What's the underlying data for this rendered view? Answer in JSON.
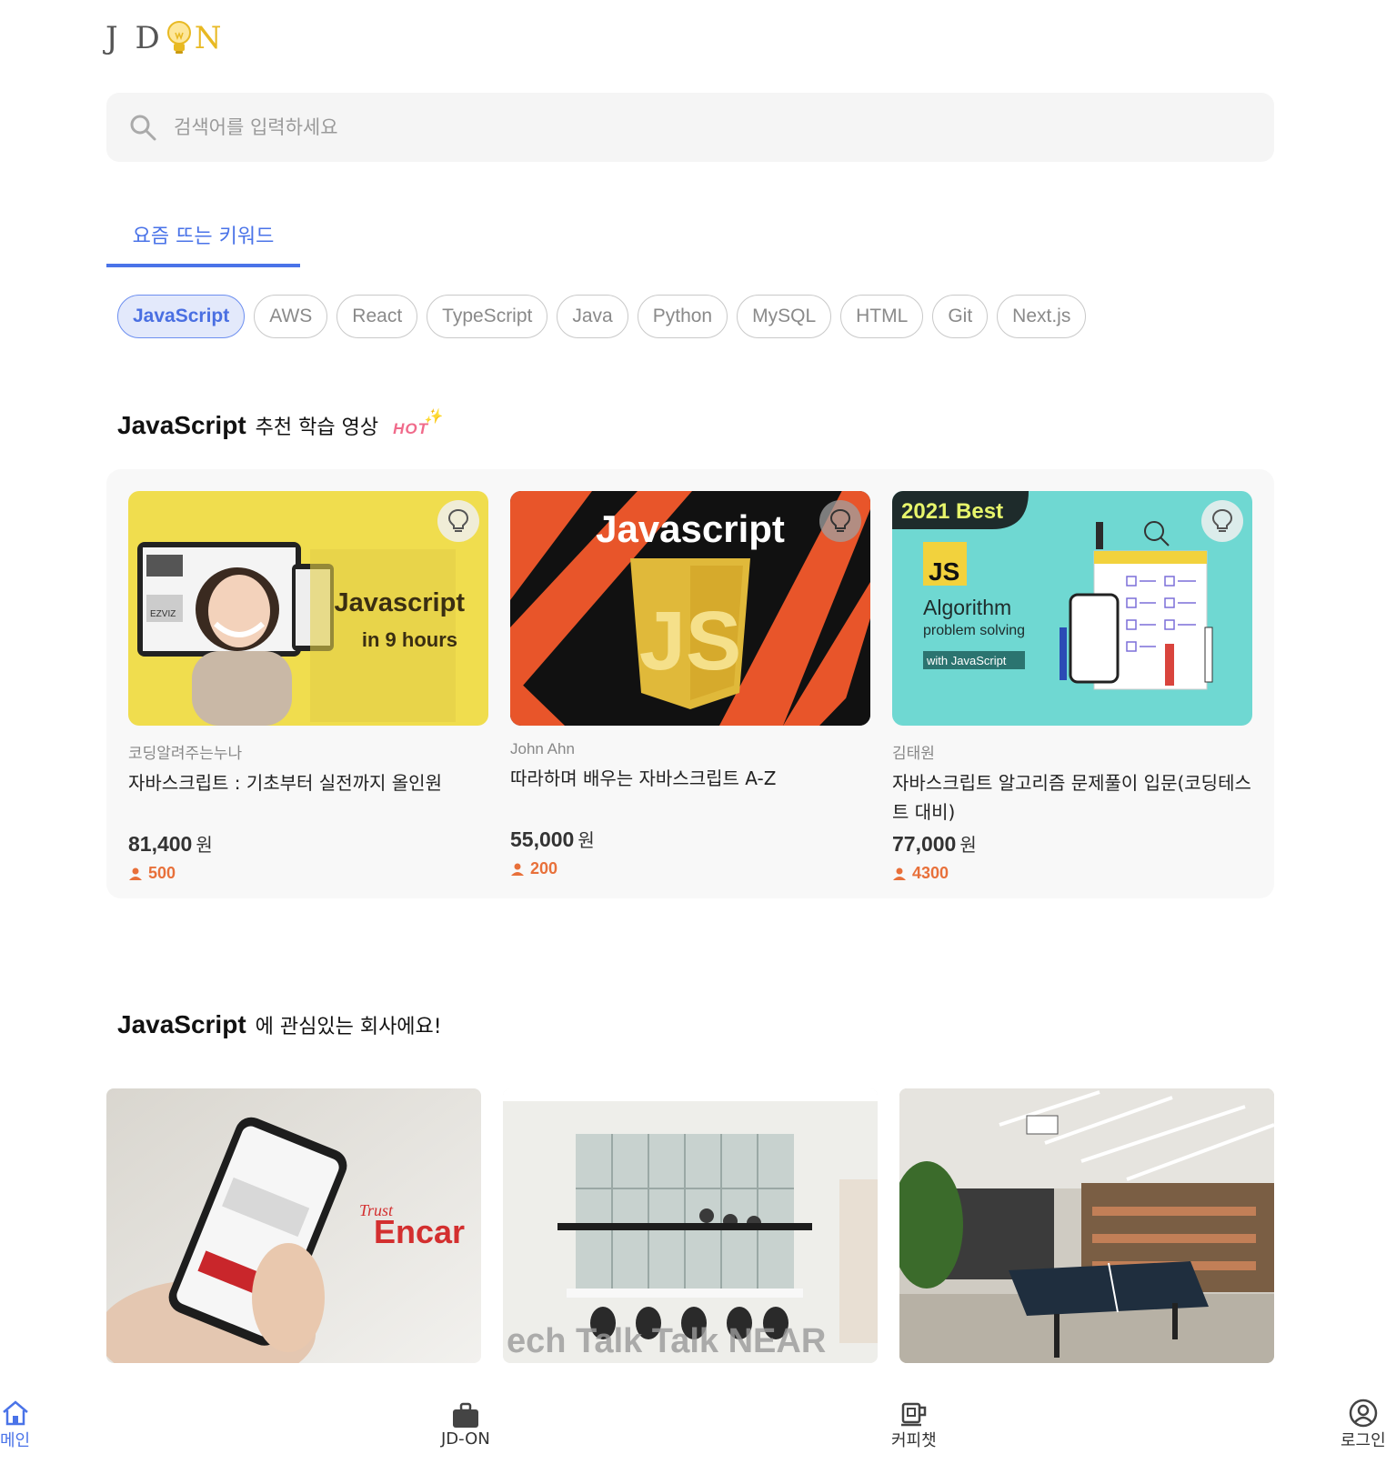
{
  "header": {
    "logo_left": "J D",
    "logo_right": "N"
  },
  "search": {
    "placeholder": "검색어를 입력하세요",
    "icon": "search-icon"
  },
  "tab": {
    "label": "요즘 뜨는 키워드"
  },
  "keywords": [
    "JavaScript",
    "AWS",
    "React",
    "TypeScript",
    "Java",
    "Python",
    "MySQL",
    "HTML",
    "Git",
    "Next.js"
  ],
  "active_keyword_index": 0,
  "videos_section": {
    "keyword": "JavaScript",
    "title_rest": "추천 학습 영상",
    "hot_badge": "HOT"
  },
  "videos": [
    {
      "author": "코딩알려주는누나",
      "title": "자바스크립트 : 기초부터 실전까지 올인원",
      "price": "81,400",
      "currency": "원",
      "students": "500",
      "thumb_line1": "Javascript",
      "thumb_line2": "in 9 hours",
      "thumb_label": "EZVIZ"
    },
    {
      "author": "John Ahn",
      "title": "따라하며 배우는 자바스크립트 A-Z",
      "price": "55,000",
      "currency": "원",
      "students": "200",
      "thumb_line1": "Javascript",
      "thumb_label": "JS"
    },
    {
      "author": "김태원",
      "title": "자바스크립트 알고리즘 문제풀이 입문(코딩테스트 대비)",
      "price": "77,000",
      "currency": "원",
      "students": "4300",
      "thumb_badge": "2021 Best",
      "thumb_js": "JS",
      "thumb_line1": "Algorithm",
      "thumb_line2": "problem solving",
      "thumb_line3": "with JavaScript"
    }
  ],
  "companies_section": {
    "keyword": "JavaScript",
    "title_rest": "에 관심있는 회사에요!"
  },
  "companies": [
    {
      "brand_script": "Trust",
      "brand": "Encar"
    },
    {
      "overlay": "ech Talk Talk NEAR"
    },
    {}
  ],
  "bottom_nav": [
    {
      "label": "메인",
      "icon": "home-icon"
    },
    {
      "label": "JD-ON",
      "icon": "briefcase-icon"
    },
    {
      "label": "커피챗",
      "icon": "coffee-cup-icon"
    },
    {
      "label": "로그인",
      "icon": "user-circle-icon"
    }
  ],
  "colors": {
    "accent": "#4a73e8",
    "orange": "#e8703a",
    "logo_gold": "#e8b923"
  }
}
